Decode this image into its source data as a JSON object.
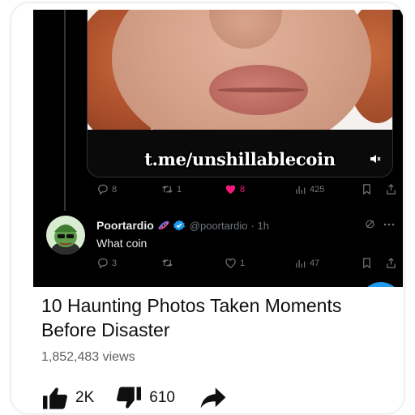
{
  "tweet": {
    "watermark": "t.me/unshillablecoin",
    "stats": {
      "replies": "8",
      "retweets": "1",
      "likes": "8",
      "views": "425"
    }
  },
  "reply": {
    "display_name": "Poortardio",
    "handle": "@poortardio",
    "time": "· 1h",
    "text": "What coin",
    "stats": {
      "replies": "3",
      "retweets": "",
      "likes": "1",
      "views": "47"
    }
  },
  "video": {
    "title": "10 Haunting Photos Taken Moments Before Disaster",
    "views": "1,852,483 views",
    "likes": "2K",
    "dislikes": "610"
  },
  "colors": {
    "like_pink": "#f91880",
    "verified_blue": "#1d9bf0",
    "muted_grey": "#71767b"
  }
}
